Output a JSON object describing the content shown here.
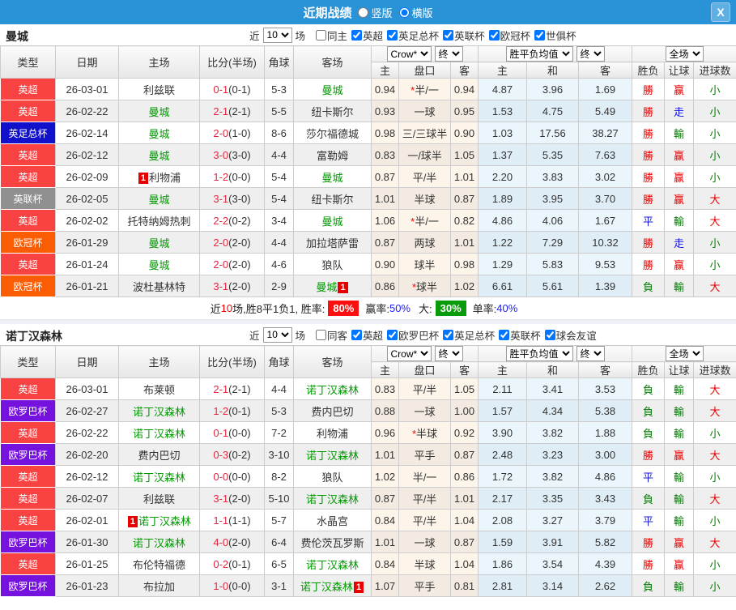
{
  "titlebar": {
    "title": "近期战绩",
    "options": [
      {
        "label": "竖版",
        "selected": false
      },
      {
        "label": "横版",
        "selected": true
      }
    ],
    "close_label": "X"
  },
  "palette": {
    "accent_blue": "#2a93d8",
    "score_red": "#e8253f",
    "team_green": "#009900",
    "card_red": "#e60000",
    "win_badge_red": "#fb0f0f",
    "big_badge_green": "#0a9b0a",
    "outcome_red": "#e60000",
    "outcome_green": "#087d08",
    "outcome_blue": "#1515dd"
  },
  "type_colors": {
    "英超": "#f94343",
    "英足总杯": "#1111cc",
    "英联杯": "#909090",
    "欧冠杯": "#fb5d05",
    "欧罗巴杯": "#7612dd"
  },
  "outcome_colors": {
    "勝": "red",
    "平": "blue",
    "負": "green",
    "赢": "red",
    "走": "blue",
    "輸": "green",
    "大": "red",
    "小": "green"
  },
  "sections": [
    {
      "team": "曼城",
      "filters": {
        "near": "近",
        "count": "10",
        "games": "场",
        "same": {
          "label": "同主",
          "checked": false
        },
        "leagues": [
          {
            "label": "英超",
            "checked": true
          },
          {
            "label": "英足总杯",
            "checked": true
          },
          {
            "label": "英联杯",
            "checked": true
          },
          {
            "label": "欧冠杯",
            "checked": true
          },
          {
            "label": "世俱杯",
            "checked": true
          }
        ]
      },
      "selects": {
        "odds": "Crow*",
        "odds_final": "终",
        "mean": "胜平负均值",
        "mean_final": "终",
        "scope": "全场"
      },
      "columns": {
        "type": "类型",
        "date": "日期",
        "home": "主场",
        "score": "比分(半场)",
        "corner": "角球",
        "away": "客场",
        "sub": [
          "主",
          "盘口",
          "客",
          "主",
          "和",
          "客",
          "胜负",
          "让球",
          "进球数"
        ]
      },
      "rows": [
        {
          "type": "英超",
          "date": "26-03-01",
          "home": {
            "name": "利兹联",
            "green": false,
            "card": ""
          },
          "score": {
            "ft": "0-1",
            "ht": "(0-1)"
          },
          "corner": "5-3",
          "away": {
            "name": "曼城",
            "green": true,
            "card": ""
          },
          "odds": [
            "0.94",
            "半/一",
            "0.94"
          ],
          "star": true,
          "mean": [
            "4.87",
            "3.96",
            "1.69"
          ],
          "outcome": [
            "勝",
            "赢",
            "小"
          ]
        },
        {
          "type": "英超",
          "date": "26-02-22",
          "home": {
            "name": "曼城",
            "green": true,
            "card": ""
          },
          "score": {
            "ft": "2-1",
            "ht": "(2-1)"
          },
          "corner": "5-5",
          "away": {
            "name": "纽卡斯尔",
            "green": false,
            "card": ""
          },
          "odds": [
            "0.93",
            "一球",
            "0.95"
          ],
          "star": false,
          "mean": [
            "1.53",
            "4.75",
            "5.49"
          ],
          "outcome": [
            "勝",
            "走",
            "小"
          ]
        },
        {
          "type": "英足总杯",
          "date": "26-02-14",
          "home": {
            "name": "曼城",
            "green": true,
            "card": ""
          },
          "score": {
            "ft": "2-0",
            "ht": "(1-0)"
          },
          "corner": "8-6",
          "away": {
            "name": "莎尔福德城",
            "green": false,
            "card": ""
          },
          "odds": [
            "0.98",
            "三/三球半",
            "0.90"
          ],
          "star": false,
          "mean": [
            "1.03",
            "17.56",
            "38.27"
          ],
          "outcome": [
            "勝",
            "輸",
            "小"
          ]
        },
        {
          "type": "英超",
          "date": "26-02-12",
          "home": {
            "name": "曼城",
            "green": true,
            "card": ""
          },
          "score": {
            "ft": "3-0",
            "ht": "(3-0)"
          },
          "corner": "4-4",
          "away": {
            "name": "富勒姆",
            "green": false,
            "card": ""
          },
          "odds": [
            "0.83",
            "一/球半",
            "1.05"
          ],
          "star": false,
          "mean": [
            "1.37",
            "5.35",
            "7.63"
          ],
          "outcome": [
            "勝",
            "赢",
            "小"
          ]
        },
        {
          "type": "英超",
          "date": "26-02-09",
          "home": {
            "name": "利物浦",
            "green": false,
            "card": "1"
          },
          "score": {
            "ft": "1-2",
            "ht": "(0-0)"
          },
          "corner": "5-4",
          "away": {
            "name": "曼城",
            "green": true,
            "card": ""
          },
          "odds": [
            "0.87",
            "平/半",
            "1.01"
          ],
          "star": false,
          "mean": [
            "2.20",
            "3.83",
            "3.02"
          ],
          "outcome": [
            "勝",
            "赢",
            "小"
          ]
        },
        {
          "type": "英联杯",
          "date": "26-02-05",
          "home": {
            "name": "曼城",
            "green": true,
            "card": ""
          },
          "score": {
            "ft": "3-1",
            "ht": "(3-0)"
          },
          "corner": "5-4",
          "away": {
            "name": "纽卡斯尔",
            "green": false,
            "card": ""
          },
          "odds": [
            "1.01",
            "半球",
            "0.87"
          ],
          "star": false,
          "mean": [
            "1.89",
            "3.95",
            "3.70"
          ],
          "outcome": [
            "勝",
            "赢",
            "大"
          ]
        },
        {
          "type": "英超",
          "date": "26-02-02",
          "home": {
            "name": "托特纳姆热刺",
            "green": false,
            "card": ""
          },
          "score": {
            "ft": "2-2",
            "ht": "(0-2)"
          },
          "corner": "3-4",
          "away": {
            "name": "曼城",
            "green": true,
            "card": ""
          },
          "odds": [
            "1.06",
            "半/一",
            "0.82"
          ],
          "star": true,
          "mean": [
            "4.86",
            "4.06",
            "1.67"
          ],
          "outcome": [
            "平",
            "輸",
            "大"
          ]
        },
        {
          "type": "欧冠杯",
          "date": "26-01-29",
          "home": {
            "name": "曼城",
            "green": true,
            "card": ""
          },
          "score": {
            "ft": "2-0",
            "ht": "(2-0)"
          },
          "corner": "4-4",
          "away": {
            "name": "加拉塔萨雷",
            "green": false,
            "card": ""
          },
          "odds": [
            "0.87",
            "两球",
            "1.01"
          ],
          "star": false,
          "mean": [
            "1.22",
            "7.29",
            "10.32"
          ],
          "outcome": [
            "勝",
            "走",
            "小"
          ]
        },
        {
          "type": "英超",
          "date": "26-01-24",
          "home": {
            "name": "曼城",
            "green": true,
            "card": ""
          },
          "score": {
            "ft": "2-0",
            "ht": "(2-0)"
          },
          "corner": "4-6",
          "away": {
            "name": "狼队",
            "green": false,
            "card": ""
          },
          "odds": [
            "0.90",
            "球半",
            "0.98"
          ],
          "star": false,
          "mean": [
            "1.29",
            "5.83",
            "9.53"
          ],
          "outcome": [
            "勝",
            "赢",
            "小"
          ]
        },
        {
          "type": "欧冠杯",
          "date": "26-01-21",
          "home": {
            "name": "波杜基林特",
            "green": false,
            "card": ""
          },
          "score": {
            "ft": "3-1",
            "ht": "(2-0)"
          },
          "corner": "2-9",
          "away": {
            "name": "曼城",
            "green": true,
            "card": "1"
          },
          "odds": [
            "0.86",
            "球半",
            "1.02"
          ],
          "star": true,
          "mean": [
            "6.61",
            "5.61",
            "1.39"
          ],
          "outcome": [
            "負",
            "輸",
            "大"
          ]
        }
      ],
      "summary": {
        "text_before": "近",
        "count": "10",
        "text_mid": "场,胜8平1负1, 胜率:",
        "win_rate": "80%",
        "asia_label": "赢率:",
        "asia_rate": "50%",
        "big_label": "大:",
        "big_rate": "30%",
        "single_label": "单率:",
        "single_rate": "40%"
      }
    },
    {
      "team": "诺丁汉森林",
      "filters": {
        "near": "近",
        "count": "10",
        "games": "场",
        "same": {
          "label": "同客",
          "checked": false
        },
        "leagues": [
          {
            "label": "英超",
            "checked": true
          },
          {
            "label": "欧罗巴杯",
            "checked": true
          },
          {
            "label": "英足总杯",
            "checked": true
          },
          {
            "label": "英联杯",
            "checked": true
          },
          {
            "label": "球会友谊",
            "checked": true
          }
        ]
      },
      "selects": {
        "odds": "Crow*",
        "odds_final": "终",
        "mean": "胜平负均值",
        "mean_final": "终",
        "scope": "全场"
      },
      "columns": {
        "type": "类型",
        "date": "日期",
        "home": "主场",
        "score": "比分(半场)",
        "corner": "角球",
        "away": "客场",
        "sub": [
          "主",
          "盘口",
          "客",
          "主",
          "和",
          "客",
          "胜负",
          "让球",
          "进球数"
        ]
      },
      "rows": [
        {
          "type": "英超",
          "date": "26-03-01",
          "home": {
            "name": "布莱顿",
            "green": false,
            "card": ""
          },
          "score": {
            "ft": "2-1",
            "ht": "(2-1)"
          },
          "corner": "4-4",
          "away": {
            "name": "诺丁汉森林",
            "green": true,
            "card": ""
          },
          "odds": [
            "0.83",
            "平/半",
            "1.05"
          ],
          "star": false,
          "mean": [
            "2.11",
            "3.41",
            "3.53"
          ],
          "outcome": [
            "負",
            "輸",
            "大"
          ]
        },
        {
          "type": "欧罗巴杯",
          "date": "26-02-27",
          "home": {
            "name": "诺丁汉森林",
            "green": true,
            "card": ""
          },
          "score": {
            "ft": "1-2",
            "ht": "(0-1)"
          },
          "corner": "5-3",
          "away": {
            "name": "费内巴切",
            "green": false,
            "card": ""
          },
          "odds": [
            "0.88",
            "一球",
            "1.00"
          ],
          "star": false,
          "mean": [
            "1.57",
            "4.34",
            "5.38"
          ],
          "outcome": [
            "負",
            "輸",
            "大"
          ]
        },
        {
          "type": "英超",
          "date": "26-02-22",
          "home": {
            "name": "诺丁汉森林",
            "green": true,
            "card": ""
          },
          "score": {
            "ft": "0-1",
            "ht": "(0-0)"
          },
          "corner": "7-2",
          "away": {
            "name": "利物浦",
            "green": false,
            "card": ""
          },
          "odds": [
            "0.96",
            "半球",
            "0.92"
          ],
          "star": true,
          "mean": [
            "3.90",
            "3.82",
            "1.88"
          ],
          "outcome": [
            "負",
            "輸",
            "小"
          ]
        },
        {
          "type": "欧罗巴杯",
          "date": "26-02-20",
          "home": {
            "name": "费内巴切",
            "green": false,
            "card": ""
          },
          "score": {
            "ft": "0-3",
            "ht": "(0-2)"
          },
          "corner": "3-10",
          "away": {
            "name": "诺丁汉森林",
            "green": true,
            "card": ""
          },
          "odds": [
            "1.01",
            "平手",
            "0.87"
          ],
          "star": false,
          "mean": [
            "2.48",
            "3.23",
            "3.00"
          ],
          "outcome": [
            "勝",
            "赢",
            "大"
          ]
        },
        {
          "type": "英超",
          "date": "26-02-12",
          "home": {
            "name": "诺丁汉森林",
            "green": true,
            "card": ""
          },
          "score": {
            "ft": "0-0",
            "ht": "(0-0)"
          },
          "corner": "8-2",
          "away": {
            "name": "狼队",
            "green": false,
            "card": ""
          },
          "odds": [
            "1.02",
            "半/一",
            "0.86"
          ],
          "star": false,
          "mean": [
            "1.72",
            "3.82",
            "4.86"
          ],
          "outcome": [
            "平",
            "輸",
            "小"
          ]
        },
        {
          "type": "英超",
          "date": "26-02-07",
          "home": {
            "name": "利兹联",
            "green": false,
            "card": ""
          },
          "score": {
            "ft": "3-1",
            "ht": "(2-0)"
          },
          "corner": "5-10",
          "away": {
            "name": "诺丁汉森林",
            "green": true,
            "card": ""
          },
          "odds": [
            "0.87",
            "平/半",
            "1.01"
          ],
          "star": false,
          "mean": [
            "2.17",
            "3.35",
            "3.43"
          ],
          "outcome": [
            "負",
            "輸",
            "大"
          ]
        },
        {
          "type": "英超",
          "date": "26-02-01",
          "home": {
            "name": "诺丁汉森林",
            "green": true,
            "card": "1"
          },
          "score": {
            "ft": "1-1",
            "ht": "(1-1)"
          },
          "corner": "5-7",
          "away": {
            "name": "水晶宫",
            "green": false,
            "card": ""
          },
          "odds": [
            "0.84",
            "平/半",
            "1.04"
          ],
          "star": false,
          "mean": [
            "2.08",
            "3.27",
            "3.79"
          ],
          "outcome": [
            "平",
            "輸",
            "小"
          ]
        },
        {
          "type": "欧罗巴杯",
          "date": "26-01-30",
          "home": {
            "name": "诺丁汉森林",
            "green": true,
            "card": ""
          },
          "score": {
            "ft": "4-0",
            "ht": "(2-0)"
          },
          "corner": "6-4",
          "away": {
            "name": "费伦茨瓦罗斯",
            "green": false,
            "card": ""
          },
          "odds": [
            "1.01",
            "一球",
            "0.87"
          ],
          "star": false,
          "mean": [
            "1.59",
            "3.91",
            "5.82"
          ],
          "outcome": [
            "勝",
            "赢",
            "大"
          ]
        },
        {
          "type": "英超",
          "date": "26-01-25",
          "home": {
            "name": "布伦特福德",
            "green": false,
            "card": ""
          },
          "score": {
            "ft": "0-2",
            "ht": "(0-1)"
          },
          "corner": "6-5",
          "away": {
            "name": "诺丁汉森林",
            "green": true,
            "card": ""
          },
          "odds": [
            "0.84",
            "半球",
            "1.04"
          ],
          "star": false,
          "mean": [
            "1.86",
            "3.54",
            "4.39"
          ],
          "outcome": [
            "勝",
            "赢",
            "小"
          ]
        },
        {
          "type": "欧罗巴杯",
          "date": "26-01-23",
          "home": {
            "name": "布拉加",
            "green": false,
            "card": ""
          },
          "score": {
            "ft": "1-0",
            "ht": "(0-0)"
          },
          "corner": "3-1",
          "away": {
            "name": "诺丁汉森林",
            "green": true,
            "card": "1"
          },
          "odds": [
            "1.07",
            "平手",
            "0.81"
          ],
          "star": false,
          "mean": [
            "2.81",
            "3.14",
            "2.62"
          ],
          "outcome": [
            "負",
            "輸",
            "小"
          ]
        }
      ]
    }
  ]
}
